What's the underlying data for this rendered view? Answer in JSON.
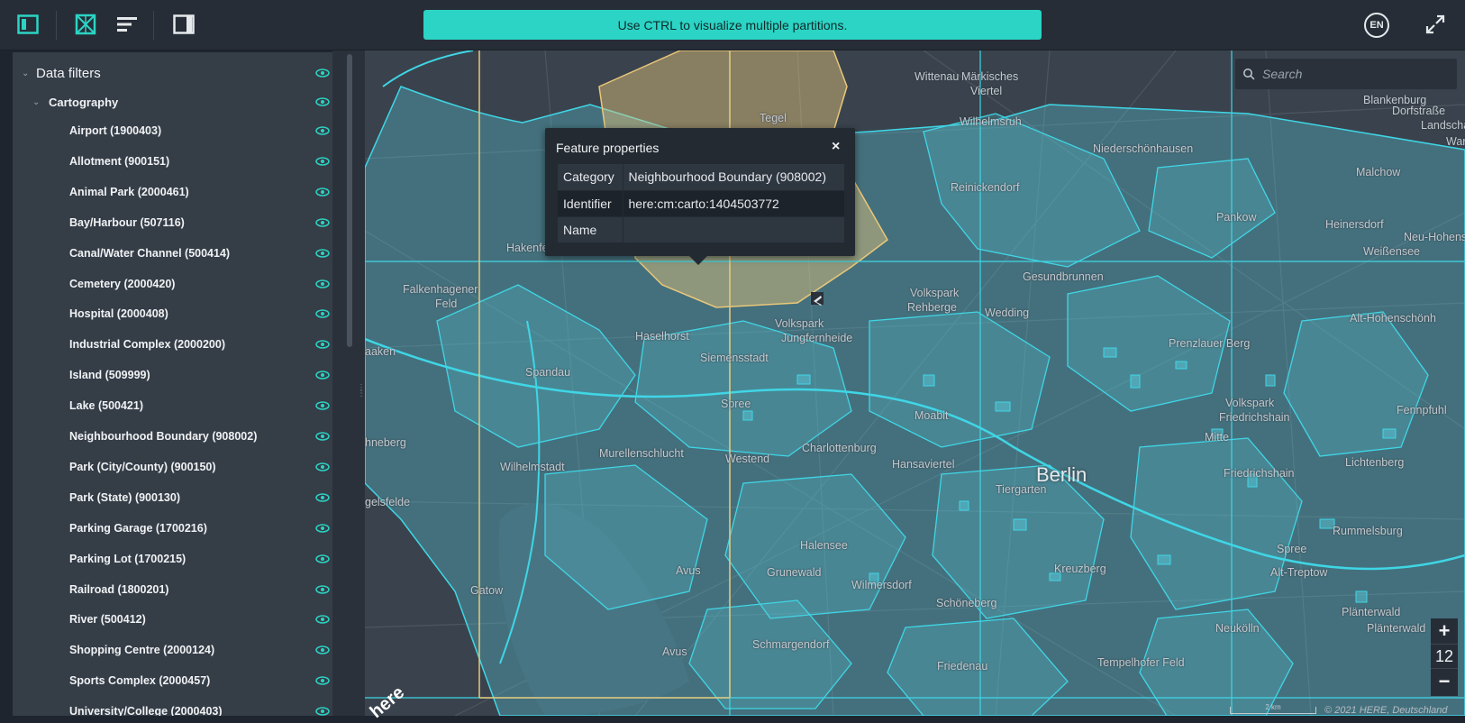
{
  "toolbar": {
    "banner_text": "Use CTRL to visualize multiple partitions.",
    "language": "EN",
    "icons": [
      "sidebar-toggle-icon",
      "partition-grid-icon",
      "list-icon",
      "panel-right-icon",
      "fullscreen-icon"
    ],
    "accent_color": "#2bd4c4"
  },
  "sidebar": {
    "header": "Data filters",
    "group": "Cartography",
    "items": [
      {
        "label": "Airport (1900403)"
      },
      {
        "label": "Allotment (900151)"
      },
      {
        "label": "Animal Park (2000461)"
      },
      {
        "label": "Bay/Harbour (507116)"
      },
      {
        "label": "Canal/Water Channel (500414)"
      },
      {
        "label": "Cemetery (2000420)"
      },
      {
        "label": "Hospital (2000408)"
      },
      {
        "label": "Industrial Complex (2000200)"
      },
      {
        "label": "Island (509999)"
      },
      {
        "label": "Lake (500421)"
      },
      {
        "label": "Neighbourhood Boundary (908002)"
      },
      {
        "label": "Park (City/County) (900150)"
      },
      {
        "label": "Park (State) (900130)"
      },
      {
        "label": "Parking Garage (1700216)"
      },
      {
        "label": "Parking Lot (1700215)"
      },
      {
        "label": "Railroad (1800201)"
      },
      {
        "label": "River (500412)"
      },
      {
        "label": "Shopping Centre (2000124)"
      },
      {
        "label": "Sports Complex (2000457)"
      },
      {
        "label": "University/College (2000403)"
      }
    ]
  },
  "search": {
    "placeholder": "Search"
  },
  "popup": {
    "title": "Feature properties",
    "close": "×",
    "rows": [
      {
        "key": "Category",
        "value": "Neighbourhood Boundary (908002)"
      },
      {
        "key": "Identifier",
        "value": "here:cm:carto:1404503772"
      },
      {
        "key": "Name",
        "value": ""
      }
    ]
  },
  "map": {
    "city": "Berlin",
    "labels": [
      "Wittenau",
      "Märkisches",
      "Viertel",
      "Tegel",
      "Wilhelmsruh",
      "Blankenburg",
      "Dorfstraße",
      "Landschaftsp",
      "Wartenb",
      "Malchow",
      "Niederschönhausen",
      "Reinickendorf",
      "Pankow",
      "Heinersdorf",
      "Weißensee",
      "Neu-Hohenschö",
      "Hakenfelde",
      "Falkenhagener",
      "Feld",
      "Gesundbrunnen",
      "Volkspark",
      "Rehberge",
      "Wedding",
      "Alt-Hohenschönh",
      "aaken",
      "Haselhorst",
      "Volkspark",
      "Jungfernheide",
      "Siemensstadt",
      "Prenzlauer Berg",
      "Spandau",
      "Fennpfuhl",
      "Spree",
      "Moabit",
      "Volkspark",
      "Friedrichshain",
      "hneberg",
      "Mitte",
      "Murellenschlucht",
      "Charlottenburg",
      "Westend",
      "Wilhelmstadt",
      "Hansaviertel",
      "Lichtenberg",
      "Tiergarten",
      "Friedrichshain",
      "gelsfelde",
      "Rummelsburg",
      "Spree",
      "Halensee",
      "Gatow",
      "Avus",
      "Grunewald",
      "Kreuzberg",
      "Alt-Treptow",
      "Wilmersdorf",
      "Schöneberg",
      "Plänterwald",
      "Plänterwald",
      "Neukölln",
      "Schmargendorf",
      "Avus",
      "Tempelhofer Feld",
      "Friedenau"
    ],
    "zoom_in": "+",
    "zoom_level": "12",
    "zoom_out": "−",
    "scale": "2 km",
    "copyright": "© 2021 HERE, Deutschland",
    "logo": "here",
    "colors": {
      "partition_line": "#3fd6e6",
      "selected_partition": "#e9c77a",
      "feature_fill": "#58c6d8"
    }
  }
}
